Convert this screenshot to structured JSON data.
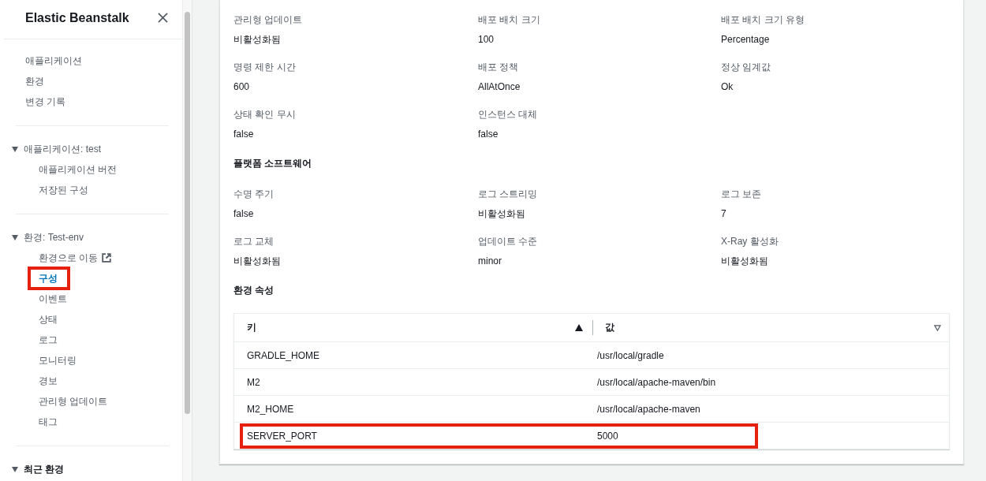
{
  "sidebar": {
    "title": "Elastic Beanstalk",
    "groups": [
      {
        "items": [
          {
            "label": "애플리케이션",
            "selected": false,
            "external": false,
            "highlighted": false
          },
          {
            "label": "환경",
            "selected": false,
            "external": false,
            "highlighted": false
          },
          {
            "label": "변경 기록",
            "selected": false,
            "external": false,
            "highlighted": false
          }
        ]
      },
      {
        "heading": "애플리케이션: test",
        "kind": "link",
        "expanded": true,
        "items": [
          {
            "label": "애플리케이션 버전",
            "selected": false,
            "external": false,
            "highlighted": false
          },
          {
            "label": "저장된 구성",
            "selected": false,
            "external": false,
            "highlighted": false
          }
        ]
      },
      {
        "heading": "환경: Test-env",
        "kind": "link",
        "expanded": true,
        "items": [
          {
            "label": "환경으로 이동",
            "selected": false,
            "external": true,
            "highlighted": false
          },
          {
            "label": "구성",
            "selected": true,
            "external": false,
            "highlighted": true
          },
          {
            "label": "이벤트",
            "selected": false,
            "external": false,
            "highlighted": false
          },
          {
            "label": "상태",
            "selected": false,
            "external": false,
            "highlighted": false
          },
          {
            "label": "로그",
            "selected": false,
            "external": false,
            "highlighted": false
          },
          {
            "label": "모니터링",
            "selected": false,
            "external": false,
            "highlighted": false
          },
          {
            "label": "경보",
            "selected": false,
            "external": false,
            "highlighted": false
          },
          {
            "label": "관리형 업데이트",
            "selected": false,
            "external": false,
            "highlighted": false
          },
          {
            "label": "태그",
            "selected": false,
            "external": false,
            "highlighted": false
          }
        ]
      },
      {
        "heading": "최근 환경",
        "kind": "section",
        "expanded": true
      }
    ]
  },
  "configuration": {
    "sections": [
      {
        "fields": [
          {
            "label": "관리형 업데이트",
            "value": "비활성화됨"
          },
          {
            "label": "배포 배치 크기",
            "value": "100"
          },
          {
            "label": "배포 배치 크기 유형",
            "value": "Percentage"
          },
          {
            "label": "명령 제한 시간",
            "value": "600"
          },
          {
            "label": "배포 정책",
            "value": "AllAtOnce"
          },
          {
            "label": "정상 임계값",
            "value": "Ok"
          },
          {
            "label": "상태 확인 무시",
            "value": "false"
          },
          {
            "label": "인스턴스 대체",
            "value": "false"
          }
        ]
      },
      {
        "heading": "플랫폼 소프트웨어",
        "fields": [
          {
            "label": "수명 주기",
            "value": "false"
          },
          {
            "label": "로그 스트리밍",
            "value": "비활성화됨"
          },
          {
            "label": "로그 보존",
            "value": "7"
          },
          {
            "label": "로그 교체",
            "value": "비활성화됨"
          },
          {
            "label": "업데이트 수준",
            "value": "minor"
          },
          {
            "label": "X-Ray 활성화",
            "value": "비활성화됨"
          }
        ]
      }
    ]
  },
  "environment_properties": {
    "heading": "환경 속성",
    "table": {
      "columns": [
        {
          "label": "키",
          "sorted": true
        },
        {
          "label": "값",
          "sorted": false
        }
      ],
      "rows": [
        {
          "cells": [
            "GRADLE_HOME",
            "/usr/local/gradle"
          ],
          "highlighted": false
        },
        {
          "cells": [
            "M2",
            "/usr/local/apache-maven/bin"
          ],
          "highlighted": false
        },
        {
          "cells": [
            "M2_HOME",
            "/usr/local/apache-maven"
          ],
          "highlighted": false
        },
        {
          "cells": [
            "SERVER_PORT",
            "5000"
          ],
          "highlighted": true
        }
      ]
    }
  }
}
